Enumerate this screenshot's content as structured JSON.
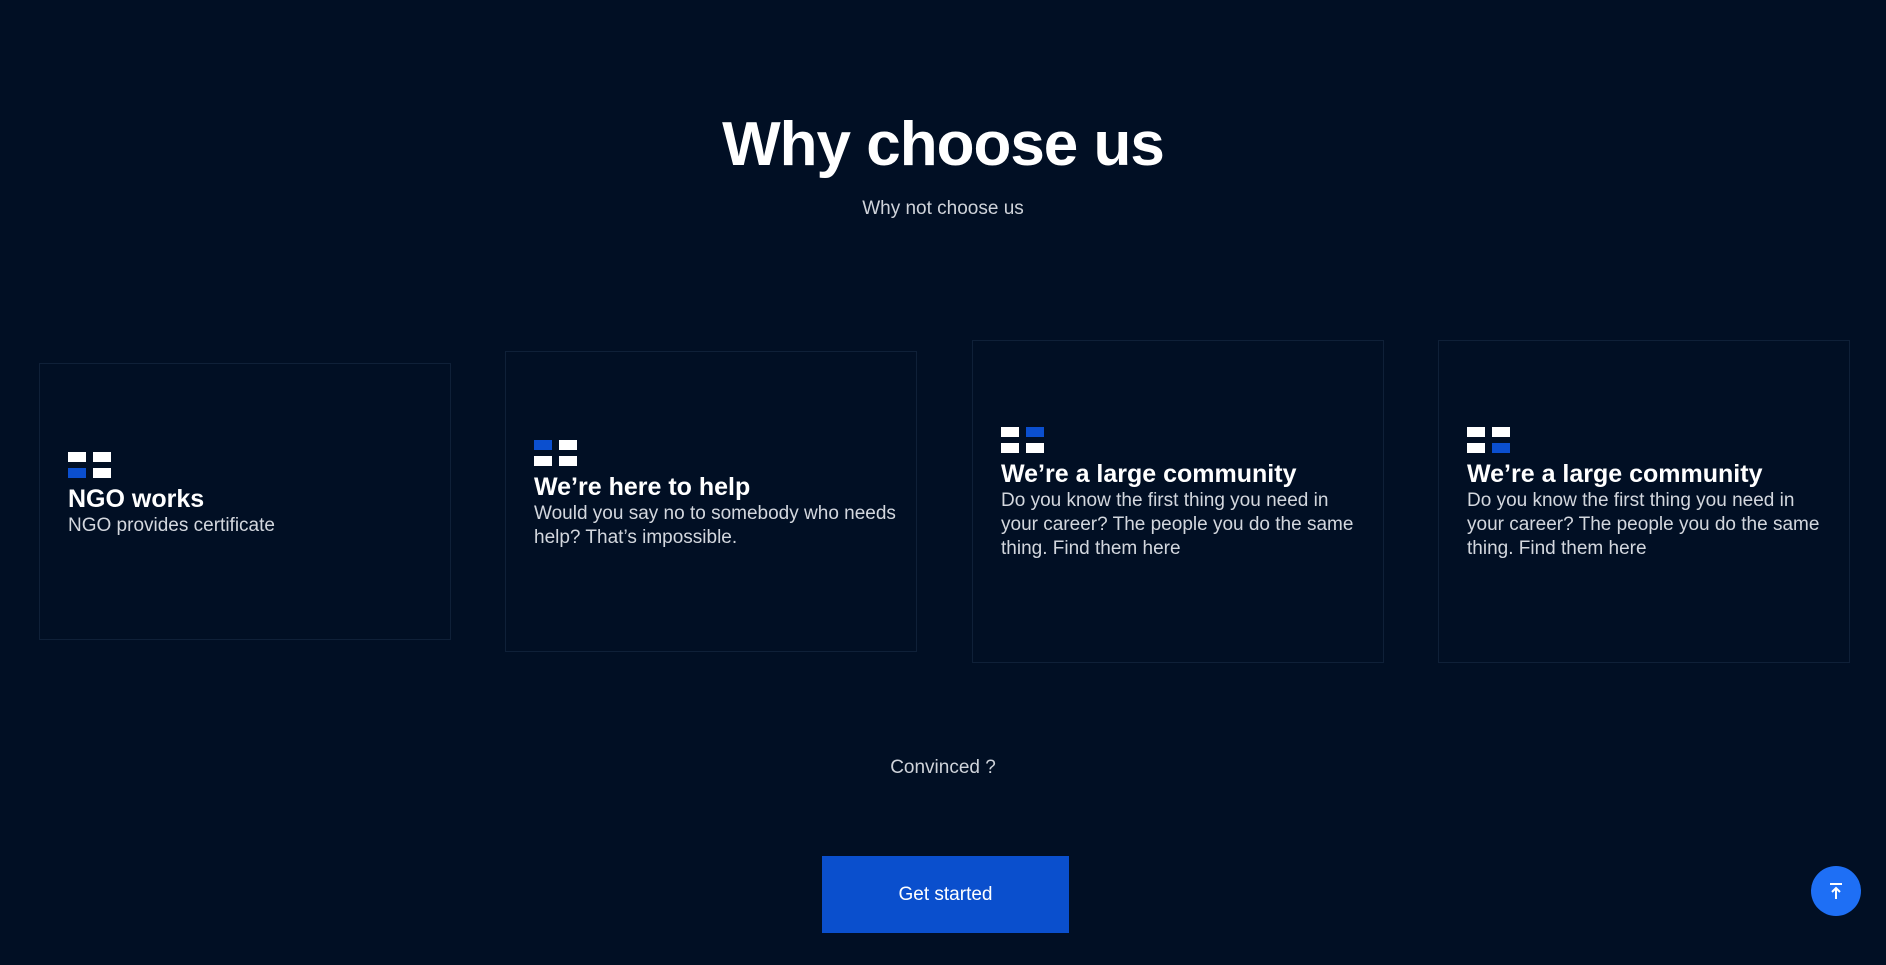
{
  "section": {
    "title": "Why choose us",
    "subtitle": "Why not choose us"
  },
  "cards": [
    {
      "title": "NGO works",
      "body": "NGO provides certificate",
      "icon": "grid-icon",
      "icon_highlight": "bottom-left"
    },
    {
      "title": "We’re here to help",
      "body": "Would you say no to somebody who needs help? That’s impossible.",
      "icon": "grid-icon",
      "icon_highlight": "top-left"
    },
    {
      "title": "We’re a large community",
      "body": "Do you know the first thing you need in your career? The people you do the same thing. Find them here",
      "icon": "grid-icon",
      "icon_highlight": "top-right"
    },
    {
      "title": "We’re a large community",
      "body": "Do you know the first thing you need in your career? The people you do the same thing. Find them here",
      "icon": "grid-icon",
      "icon_highlight": "bottom-right"
    }
  ],
  "cta": {
    "prompt": "Convinced ?",
    "button_label": "Get started"
  },
  "scroll_top": {
    "icon": "arrow-up-to-top-icon"
  },
  "colors": {
    "background": "#010f24",
    "accent": "#0a4fcd",
    "scroll_button": "#1e6ff5",
    "card_border": "#0f2038"
  }
}
